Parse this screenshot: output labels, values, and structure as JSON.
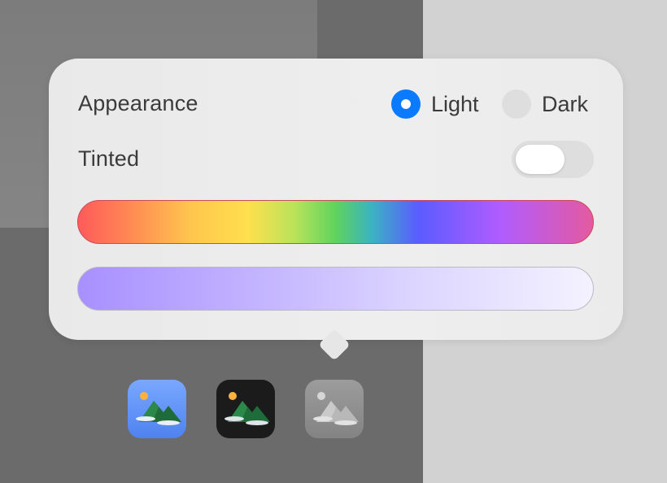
{
  "popover": {
    "appearance_label": "Appearance",
    "tinted_label": "Tinted",
    "appearance_options": [
      {
        "label": "Light",
        "selected": true
      },
      {
        "label": "Dark",
        "selected": false
      }
    ],
    "tinted_enabled": false,
    "hue_slider": {
      "gradient": [
        "#ff5a5a",
        "#ffc64d",
        "#5fd35d",
        "#5a5cff",
        "#b05cff",
        "#e45aa0"
      ]
    },
    "saturation_slider": {
      "gradient": [
        "#a890ff",
        "#f4f2ff"
      ]
    },
    "accent_color": "#0a7aff"
  },
  "icon_styles": [
    {
      "name": "default",
      "icon": "landscape-icon",
      "background": "#5f8ff6"
    },
    {
      "name": "dark",
      "icon": "landscape-icon",
      "background": "#1b1b1b"
    },
    {
      "name": "tinted",
      "icon": "landscape-icon",
      "background": "#8f8f8f"
    }
  ]
}
